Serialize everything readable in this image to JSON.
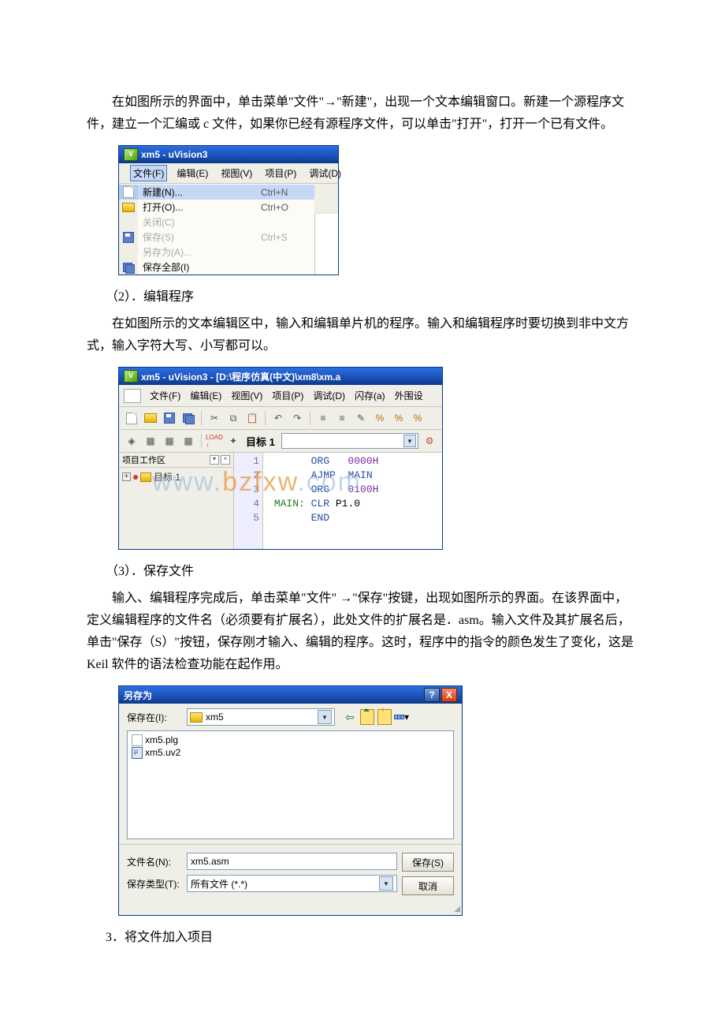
{
  "text": {
    "para1": "在如图所示的界面中，单击菜单\"文件\"→\"新建\"，出现一个文本编辑窗口。新建一个源程序文件，建立一个汇编或 c 文件，如果你已经有源程序文件，可以单击\"打开\"，打开一个已有文件。",
    "sec2": "（2）．编辑程序",
    "para2": "在如图所示的文本编辑区中，输入和编辑单片机的程序。输入和编辑程序时要切换到非中文方式，输入字符大写、小写都可以。",
    "sec3": "（3）．保存文件",
    "para3": "输入、编辑程序完成后，单击菜单\"文件\" →\"保存\"按键，出现如图所示的界面。在该界面中，定义编辑程序的文件名（必须要有扩展名），此处文件的扩展名是．asm。输入文件及其扩展名后，单击\"保存（S）\"按钮，保存刚才输入、编辑的程序。这时，程序中的指令的颜色发生了变化，这是 Keil 软件的语法检查功能在起作用。",
    "sec4": "3．将文件加入项目"
  },
  "watermark": "www.bzfxw.com",
  "fig1": {
    "title": "xm5 - uVision3",
    "menu": {
      "file": "文件(F)",
      "edit": "编辑(E)",
      "view": "视图(V)",
      "project": "项目(P)",
      "debug": "调试(D)"
    },
    "items": {
      "new": "新建(N)...",
      "new_sc": "Ctrl+N",
      "open": "打开(O)...",
      "open_sc": "Ctrl+O",
      "close": "关闭(C)",
      "save": "保存(S)",
      "save_sc": "Ctrl+S",
      "saveas": "另存为(A)...",
      "saveall": "保存全部(I)"
    }
  },
  "fig2": {
    "title": "xm5  - uVision3 - [D:\\程序仿真(中文)\\xm8\\xm.a",
    "menu": {
      "file": "文件(F)",
      "edit": "编辑(E)",
      "view": "视图(V)",
      "project": "项目(P)",
      "debug": "调试(D)",
      "flash": "闪存(a)",
      "periph": "外围设"
    },
    "target_label": "目标 1",
    "side_header": "项目工作区",
    "tree_node": "目标 1",
    "line": {
      "n1": "1",
      "n2": "2",
      "n3": "3",
      "n4": "4",
      "n5": "5",
      "l1a": "ORG",
      "l1b": "0000H",
      "l2a": "AJMP",
      "l2b": "MAIN",
      "l3a": "ORG",
      "l3b": "0100H",
      "l4lbl": "MAIN:",
      "l4a": "CLR",
      "l4b": "P1.0",
      "l5a": "END"
    }
  },
  "fig3": {
    "title": "另存为",
    "help": "?",
    "close": "X",
    "savein": "保存在(I):",
    "folder": "xm5",
    "files": {
      "plg": "xm5.plg",
      "uv2": "xm5.uv2"
    },
    "fn_label": "文件名(N):",
    "fn_value": "xm5.asm",
    "type_label": "保存类型(T):",
    "type_value": "所有文件 (*.*)",
    "save_btn": "保存(S)",
    "cancel_btn": "取消"
  }
}
